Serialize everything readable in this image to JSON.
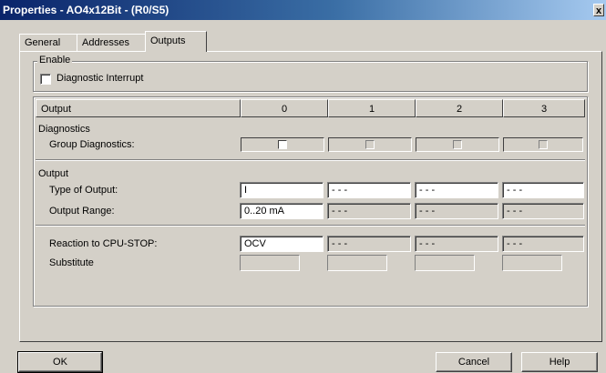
{
  "window": {
    "title": "Properties - AO4x12Bit - (R0/S5)",
    "close_label": "x"
  },
  "tabs": [
    {
      "label": "General"
    },
    {
      "label": "Addresses"
    },
    {
      "label": "Outputs",
      "active": true
    }
  ],
  "enable": {
    "legend": "Enable",
    "diagnostic_interrupt": {
      "label": "Diagnostic Interrupt",
      "checked": false
    }
  },
  "table": {
    "header": [
      "Output",
      "0",
      "1",
      "2",
      "3"
    ],
    "diagnostics": {
      "section_label": "Diagnostics",
      "group_diagnostics": {
        "label": "Group Diagnostics:",
        "values": [
          false,
          false,
          false,
          false
        ]
      }
    },
    "output": {
      "section_label": "Output",
      "type_of_output": {
        "label": "Type of Output:",
        "values": [
          "I",
          "- - -",
          "- - -",
          "- - -"
        ]
      },
      "output_range": {
        "label": "Output Range:",
        "values": [
          "0..20 mA",
          "- - -",
          "- - -",
          "- - -"
        ]
      }
    },
    "reaction": {
      "reaction_to_cpu_stop": {
        "label": "Reaction to CPU-STOP:",
        "values": [
          "OCV",
          "- - -",
          "- - -",
          "- - -"
        ]
      },
      "substitute": {
        "label": "Substitute",
        "values": [
          "",
          "",
          "",
          ""
        ]
      }
    }
  },
  "buttons": {
    "ok": "OK",
    "cancel": "Cancel",
    "help": "Help"
  }
}
